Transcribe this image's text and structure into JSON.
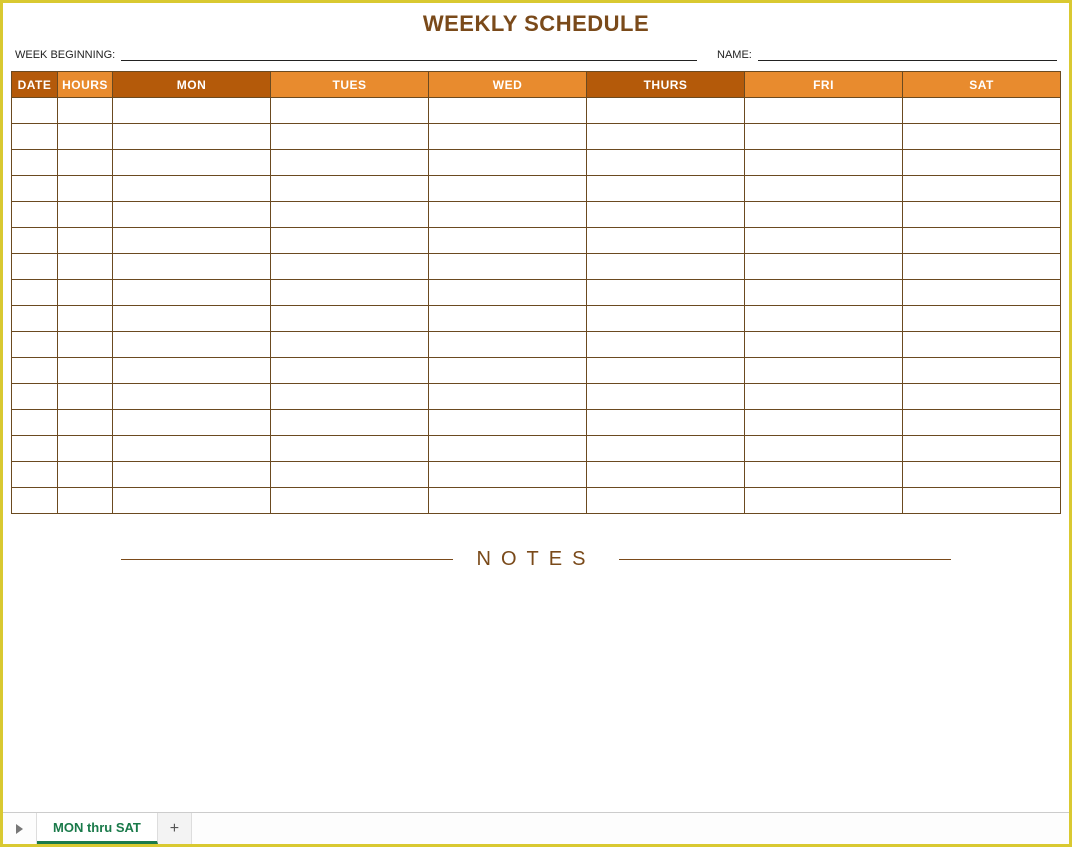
{
  "title": "WEEKLY SCHEDULE",
  "meta": {
    "week_label": "WEEK BEGINNING:",
    "week_value": "",
    "name_label": "NAME:",
    "name_value": ""
  },
  "columns": [
    {
      "label": "DATE",
      "shade": "dk"
    },
    {
      "label": "HOURS",
      "shade": "lt"
    },
    {
      "label": "MON",
      "shade": "dk"
    },
    {
      "label": "TUES",
      "shade": "lt"
    },
    {
      "label": "WED",
      "shade": "lt"
    },
    {
      "label": "THURS",
      "shade": "dk"
    },
    {
      "label": "FRI",
      "shade": "lt"
    },
    {
      "label": "SAT",
      "shade": "lt"
    }
  ],
  "row_count": 16,
  "notes_label": "NOTES",
  "tabs": {
    "active": "MON thru SAT"
  }
}
